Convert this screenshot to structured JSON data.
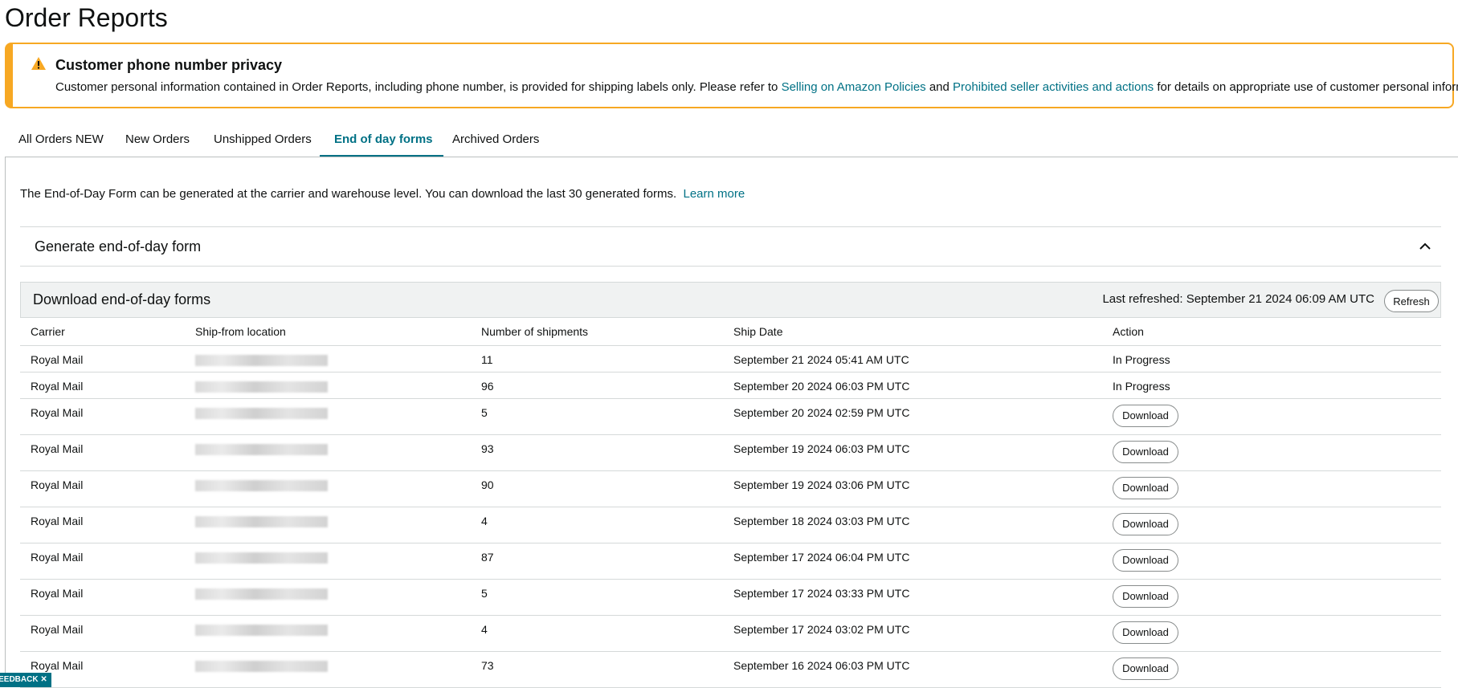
{
  "page": {
    "title": "Order Reports"
  },
  "alert": {
    "title": "Customer phone number privacy",
    "text_before": "Customer personal information contained in Order Reports, including phone number, is provided for shipping labels only. Please refer to ",
    "link1": "Selling on Amazon Policies",
    "text_mid": " and ",
    "link2": "Prohibited seller activities and actions",
    "text_after": " for details on appropriate use of customer personal information.",
    "icon": "warning-icon"
  },
  "tabs": [
    {
      "label": "All Orders NEW"
    },
    {
      "label": "New Orders"
    },
    {
      "label": "Unshipped Orders"
    },
    {
      "label": "End of day forms"
    },
    {
      "label": "Archived Orders"
    }
  ],
  "intro": {
    "text": "The End-of-Day Form can be generated at the carrier and warehouse level. You can download the last 30 generated forms.",
    "link": "Learn more"
  },
  "generate": {
    "title": "Generate end-of-day form",
    "icon": "chevron-up-icon"
  },
  "download_section": {
    "title": "Download end-of-day forms",
    "last_refreshed": "Last refreshed: September 21 2024 06:09 AM UTC",
    "refresh_label": "Refresh"
  },
  "table": {
    "headers": [
      "Carrier",
      "Ship-from location",
      "Number of shipments",
      "Ship Date",
      "Action"
    ],
    "rows": [
      {
        "carrier": "Royal Mail",
        "shipments": "11",
        "date": "September 21 2024 05:41 AM UTC",
        "action": "In Progress"
      },
      {
        "carrier": "Royal Mail",
        "shipments": "96",
        "date": "September 20 2024 06:03 PM UTC",
        "action": "In Progress"
      },
      {
        "carrier": "Royal Mail",
        "shipments": "5",
        "date": "September 20 2024 02:59 PM UTC",
        "action": "Download"
      },
      {
        "carrier": "Royal Mail",
        "shipments": "93",
        "date": "September 19 2024 06:03 PM UTC",
        "action": "Download"
      },
      {
        "carrier": "Royal Mail",
        "shipments": "90",
        "date": "September 19 2024 03:06 PM UTC",
        "action": "Download"
      },
      {
        "carrier": "Royal Mail",
        "shipments": "4",
        "date": "September 18 2024 03:03 PM UTC",
        "action": "Download"
      },
      {
        "carrier": "Royal Mail",
        "shipments": "87",
        "date": "September 17 2024 06:04 PM UTC",
        "action": "Download"
      },
      {
        "carrier": "Royal Mail",
        "shipments": "5",
        "date": "September 17 2024 03:33 PM UTC",
        "action": "Download"
      },
      {
        "carrier": "Royal Mail",
        "shipments": "4",
        "date": "September 17 2024 03:02 PM UTC",
        "action": "Download"
      },
      {
        "carrier": "Royal Mail",
        "shipments": "73",
        "date": "September 16 2024 06:03 PM UTC",
        "action": "Download"
      }
    ]
  },
  "feedback": {
    "label": "FEEDBACK ✕"
  },
  "colors": {
    "accent": "#007185",
    "warning": "#f7a823"
  }
}
